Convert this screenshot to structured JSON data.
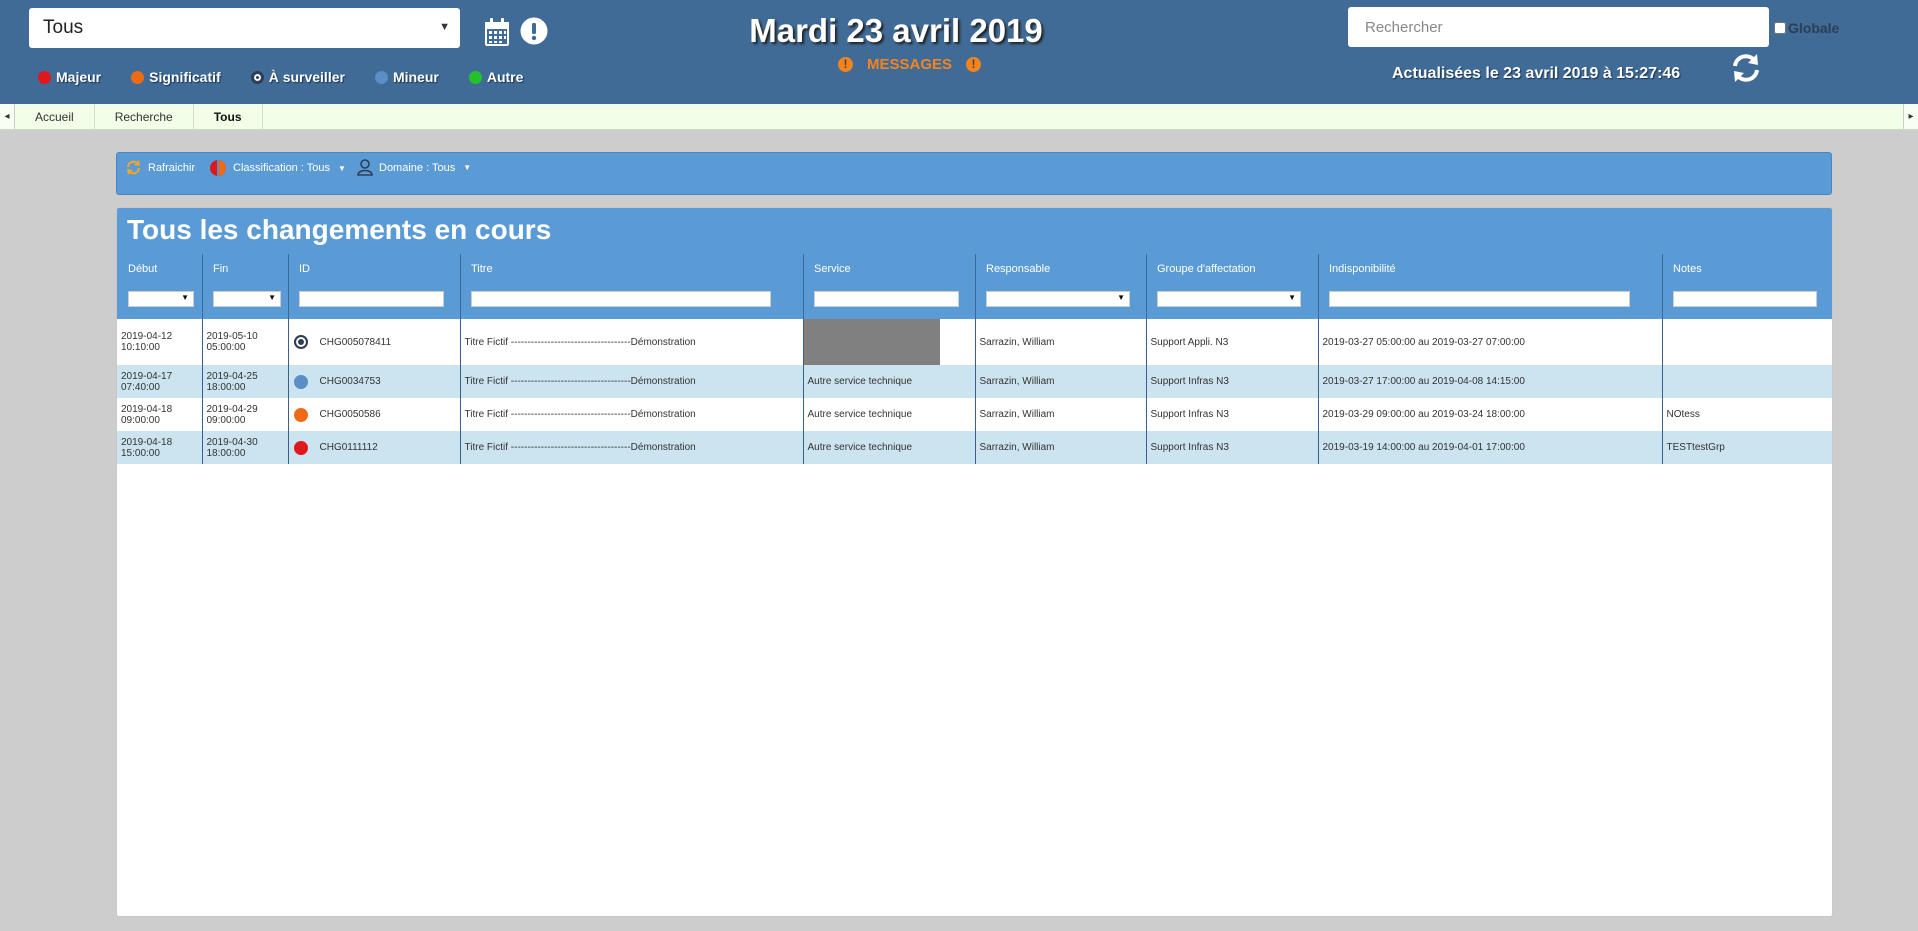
{
  "header": {
    "scope_select": "Tous",
    "date_title": "Mardi 23 avril 2019",
    "messages_label": "MESSAGES",
    "search_placeholder": "Rechercher",
    "globale_label": "Globale",
    "updated_text": "Actualisées le 23 avril 2019 à 15:27:46"
  },
  "legend": [
    {
      "label": "Majeur",
      "color": "#e0171d"
    },
    {
      "label": "Significatif",
      "color": "#f06a14"
    },
    {
      "label": "À surveiller",
      "color": "#2c3e55"
    },
    {
      "label": "Mineur",
      "color": "#5b8ec4"
    },
    {
      "label": "Autre",
      "color": "#22c22a"
    }
  ],
  "tabs": [
    {
      "label": "Accueil"
    },
    {
      "label": "Recherche"
    },
    {
      "label": "Tous"
    }
  ],
  "toolbar": {
    "refresh_label": "Rafraichir",
    "classification_label": "Classification : Tous",
    "domain_label": "Domaine : Tous"
  },
  "panel": {
    "title": "Tous les changements en cours",
    "columns": [
      "Début",
      "Fin",
      "ID",
      "Titre",
      "Service",
      "Responsable",
      "Groupe d'affectation",
      "Indisponibilité",
      "Notes"
    ]
  },
  "rows": [
    {
      "debut_date": "2019-04-12",
      "debut_time": "10:10:00",
      "fin_date": "2019-05-10",
      "fin_time": "05:00:00",
      "priority": "watch",
      "id": "CHG005078411",
      "titre": "Titre Fictif ------------------------------------Démonstration",
      "service": "",
      "responsable": "Sarrazin, William",
      "groupe": "Support Appli. N3",
      "indispo": "2019-03-27 05:00:00 au 2019-03-27 07:00:00",
      "notes": ""
    },
    {
      "debut_date": "2019-04-17",
      "debut_time": "07:40:00",
      "fin_date": "2019-04-25",
      "fin_time": "18:00:00",
      "priority": "minor",
      "id": "CHG0034753",
      "titre": "Titre Fictif ------------------------------------Démonstration",
      "service": "Autre service technique",
      "responsable": "Sarrazin, William",
      "groupe": "Support Infras N3",
      "indispo": "2019-03-27 17:00:00 au 2019-04-08 14:15:00",
      "notes": ""
    },
    {
      "debut_date": "2019-04-18",
      "debut_time": "09:00:00",
      "fin_date": "2019-04-29",
      "fin_time": "09:00:00",
      "priority": "significant",
      "id": "CHG0050586",
      "titre": "Titre Fictif ------------------------------------Démonstration",
      "service": "Autre service technique",
      "responsable": "Sarrazin, William",
      "groupe": "Support Infras N3",
      "indispo": "2019-03-29 09:00:00 au 2019-03-24 18:00:00",
      "notes": "NOtess"
    },
    {
      "debut_date": "2019-04-18",
      "debut_time": "15:00:00",
      "fin_date": "2019-04-30",
      "fin_time": "18:00:00",
      "priority": "major",
      "id": "CHG0111112",
      "titre": "Titre Fictif ------------------------------------Démonstration",
      "service": "Autre service technique",
      "responsable": "Sarrazin, William",
      "groupe": "Support Infras N3",
      "indispo": "2019-03-19 14:00:00 au 2019-04-01 17:00:00",
      "notes": "TESTtestGrp"
    }
  ]
}
